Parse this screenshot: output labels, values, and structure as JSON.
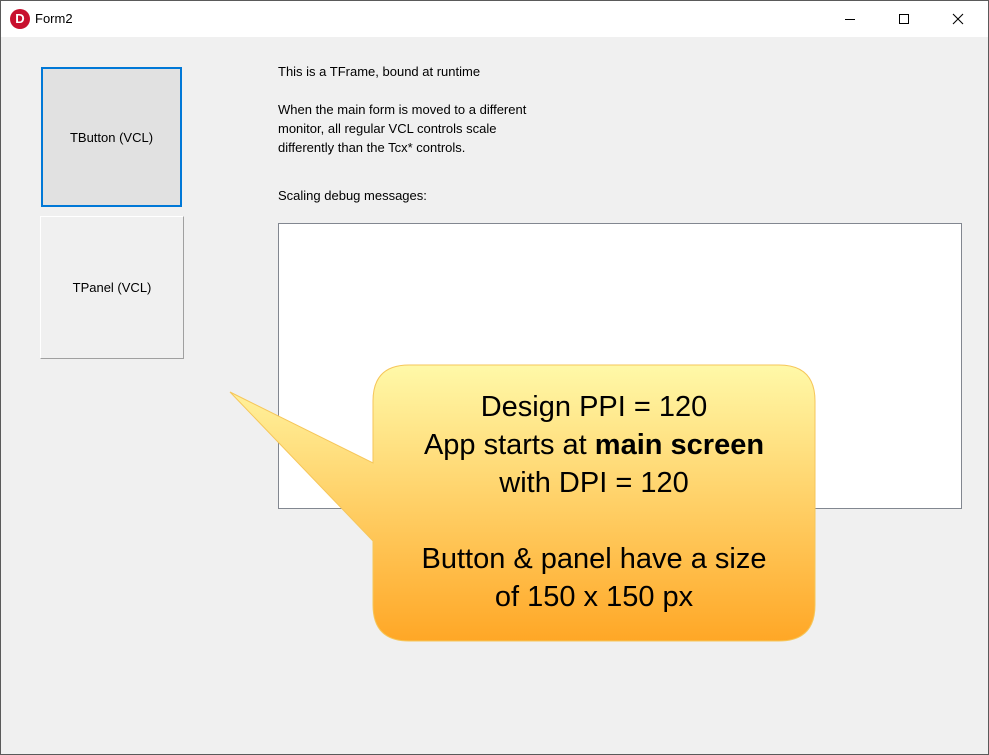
{
  "window": {
    "title": "Form2",
    "icon_letter": "D"
  },
  "controls": {
    "button_label": "TButton (VCL)",
    "panel_label": "TPanel (VCL)"
  },
  "frame_text": {
    "line1": "This is a TFrame, bound at runtime",
    "para_line1": "When the main form is moved to a different",
    "para_line2": "monitor, all regular VCL controls scale",
    "para_line3": "differently than the Tcx* controls.",
    "memo_label": "Scaling debug messages:"
  },
  "memo": {
    "value": ""
  },
  "callout": {
    "line1": "Design PPI = 120",
    "line2_prefix": "App starts at ",
    "line2_bold": "main screen",
    "line3": "with DPI = 120",
    "line4": "Button & panel have a size",
    "line5": "of 150 x 150 px",
    "gradient_top": "#fff9a8",
    "gradient_bottom": "#ffa726"
  }
}
